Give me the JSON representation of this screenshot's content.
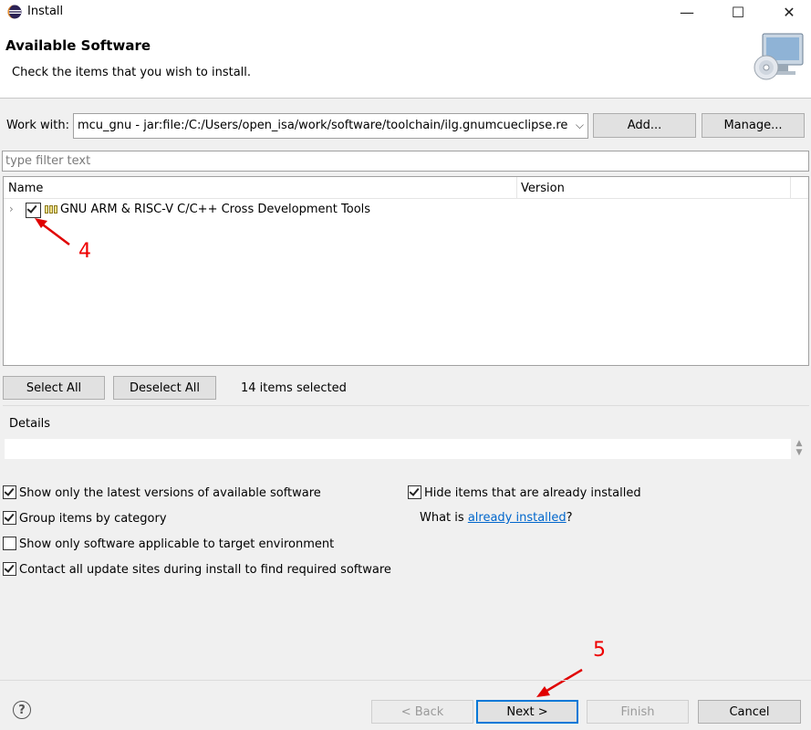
{
  "window": {
    "title": "Install",
    "minimize_glyph": "—",
    "maximize_glyph": "☐",
    "close_glyph": "✕"
  },
  "header": {
    "title": "Available Software",
    "description": "Check the items that you wish to install."
  },
  "work_with": {
    "label": "Work with:",
    "value": "mcu_gnu - jar:file:/C:/Users/open_isa/work/software/toolchain/ilg.gnumcueclipse.repos",
    "add_label": "Add...",
    "manage_label": "Manage..."
  },
  "filter": {
    "placeholder": "type filter text"
  },
  "table": {
    "columns": [
      "Name",
      "Version"
    ],
    "rows": [
      {
        "label": "GNU ARM & RISC-V C/C++ Cross Development Tools",
        "checked": true,
        "version": ""
      }
    ]
  },
  "selection": {
    "select_all_label": "Select All",
    "deselect_all_label": "Deselect All",
    "count_text": "14 items selected"
  },
  "details": {
    "label": "Details"
  },
  "options": {
    "latest_versions": {
      "label": "Show only the latest versions of available software",
      "checked": true
    },
    "group_by_category": {
      "label": "Group items by category",
      "checked": true
    },
    "applicable_only": {
      "label": "Show only software applicable to target environment",
      "checked": false
    },
    "contact_sites": {
      "label": "Contact all update sites during install to find required software",
      "checked": true
    },
    "hide_installed": {
      "label": "Hide items that are already installed",
      "checked": true
    },
    "what_is_prefix": "What is ",
    "what_is_link": "already installed",
    "what_is_suffix": "?"
  },
  "annotations": {
    "step_4": "4",
    "step_5": "5",
    "color": "#e00000"
  },
  "footer": {
    "help_glyph": "?",
    "back_label": "< Back",
    "next_label": "Next >",
    "finish_label": "Finish",
    "cancel_label": "Cancel"
  },
  "icons": {
    "app": "eclipse-icon",
    "header_art": "computer-disc-icon",
    "package": "feature-icon",
    "help": "help-icon"
  },
  "colors": {
    "accent": "#0078d7",
    "link": "#0066cc"
  }
}
